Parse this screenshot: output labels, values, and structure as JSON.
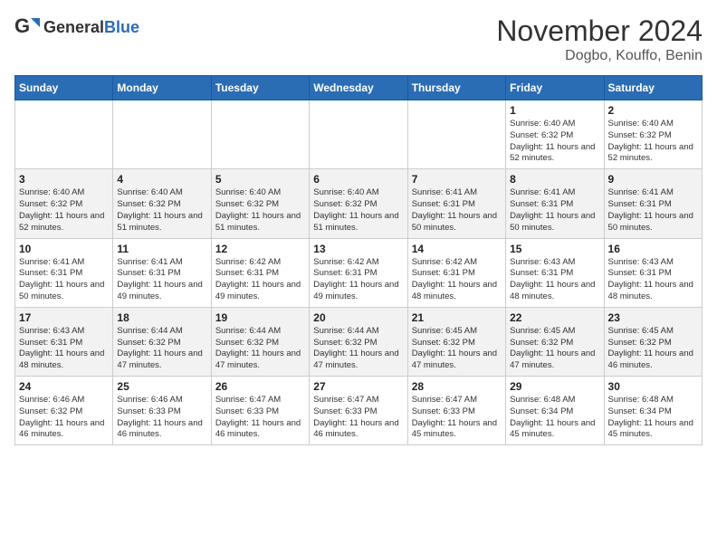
{
  "header": {
    "logo_general": "General",
    "logo_blue": "Blue",
    "month": "November 2024",
    "location": "Dogbo, Kouffo, Benin"
  },
  "days_of_week": [
    "Sunday",
    "Monday",
    "Tuesday",
    "Wednesday",
    "Thursday",
    "Friday",
    "Saturday"
  ],
  "weeks": [
    [
      {
        "day": "",
        "info": ""
      },
      {
        "day": "",
        "info": ""
      },
      {
        "day": "",
        "info": ""
      },
      {
        "day": "",
        "info": ""
      },
      {
        "day": "",
        "info": ""
      },
      {
        "day": "1",
        "info": "Sunrise: 6:40 AM\nSunset: 6:32 PM\nDaylight: 11 hours and 52 minutes."
      },
      {
        "day": "2",
        "info": "Sunrise: 6:40 AM\nSunset: 6:32 PM\nDaylight: 11 hours and 52 minutes."
      }
    ],
    [
      {
        "day": "3",
        "info": "Sunrise: 6:40 AM\nSunset: 6:32 PM\nDaylight: 11 hours and 52 minutes."
      },
      {
        "day": "4",
        "info": "Sunrise: 6:40 AM\nSunset: 6:32 PM\nDaylight: 11 hours and 51 minutes."
      },
      {
        "day": "5",
        "info": "Sunrise: 6:40 AM\nSunset: 6:32 PM\nDaylight: 11 hours and 51 minutes."
      },
      {
        "day": "6",
        "info": "Sunrise: 6:40 AM\nSunset: 6:32 PM\nDaylight: 11 hours and 51 minutes."
      },
      {
        "day": "7",
        "info": "Sunrise: 6:41 AM\nSunset: 6:31 PM\nDaylight: 11 hours and 50 minutes."
      },
      {
        "day": "8",
        "info": "Sunrise: 6:41 AM\nSunset: 6:31 PM\nDaylight: 11 hours and 50 minutes."
      },
      {
        "day": "9",
        "info": "Sunrise: 6:41 AM\nSunset: 6:31 PM\nDaylight: 11 hours and 50 minutes."
      }
    ],
    [
      {
        "day": "10",
        "info": "Sunrise: 6:41 AM\nSunset: 6:31 PM\nDaylight: 11 hours and 50 minutes."
      },
      {
        "day": "11",
        "info": "Sunrise: 6:41 AM\nSunset: 6:31 PM\nDaylight: 11 hours and 49 minutes."
      },
      {
        "day": "12",
        "info": "Sunrise: 6:42 AM\nSunset: 6:31 PM\nDaylight: 11 hours and 49 minutes."
      },
      {
        "day": "13",
        "info": "Sunrise: 6:42 AM\nSunset: 6:31 PM\nDaylight: 11 hours and 49 minutes."
      },
      {
        "day": "14",
        "info": "Sunrise: 6:42 AM\nSunset: 6:31 PM\nDaylight: 11 hours and 48 minutes."
      },
      {
        "day": "15",
        "info": "Sunrise: 6:43 AM\nSunset: 6:31 PM\nDaylight: 11 hours and 48 minutes."
      },
      {
        "day": "16",
        "info": "Sunrise: 6:43 AM\nSunset: 6:31 PM\nDaylight: 11 hours and 48 minutes."
      }
    ],
    [
      {
        "day": "17",
        "info": "Sunrise: 6:43 AM\nSunset: 6:31 PM\nDaylight: 11 hours and 48 minutes."
      },
      {
        "day": "18",
        "info": "Sunrise: 6:44 AM\nSunset: 6:32 PM\nDaylight: 11 hours and 47 minutes."
      },
      {
        "day": "19",
        "info": "Sunrise: 6:44 AM\nSunset: 6:32 PM\nDaylight: 11 hours and 47 minutes."
      },
      {
        "day": "20",
        "info": "Sunrise: 6:44 AM\nSunset: 6:32 PM\nDaylight: 11 hours and 47 minutes."
      },
      {
        "day": "21",
        "info": "Sunrise: 6:45 AM\nSunset: 6:32 PM\nDaylight: 11 hours and 47 minutes."
      },
      {
        "day": "22",
        "info": "Sunrise: 6:45 AM\nSunset: 6:32 PM\nDaylight: 11 hours and 47 minutes."
      },
      {
        "day": "23",
        "info": "Sunrise: 6:45 AM\nSunset: 6:32 PM\nDaylight: 11 hours and 46 minutes."
      }
    ],
    [
      {
        "day": "24",
        "info": "Sunrise: 6:46 AM\nSunset: 6:32 PM\nDaylight: 11 hours and 46 minutes."
      },
      {
        "day": "25",
        "info": "Sunrise: 6:46 AM\nSunset: 6:33 PM\nDaylight: 11 hours and 46 minutes."
      },
      {
        "day": "26",
        "info": "Sunrise: 6:47 AM\nSunset: 6:33 PM\nDaylight: 11 hours and 46 minutes."
      },
      {
        "day": "27",
        "info": "Sunrise: 6:47 AM\nSunset: 6:33 PM\nDaylight: 11 hours and 46 minutes."
      },
      {
        "day": "28",
        "info": "Sunrise: 6:47 AM\nSunset: 6:33 PM\nDaylight: 11 hours and 45 minutes."
      },
      {
        "day": "29",
        "info": "Sunrise: 6:48 AM\nSunset: 6:34 PM\nDaylight: 11 hours and 45 minutes."
      },
      {
        "day": "30",
        "info": "Sunrise: 6:48 AM\nSunset: 6:34 PM\nDaylight: 11 hours and 45 minutes."
      }
    ]
  ]
}
